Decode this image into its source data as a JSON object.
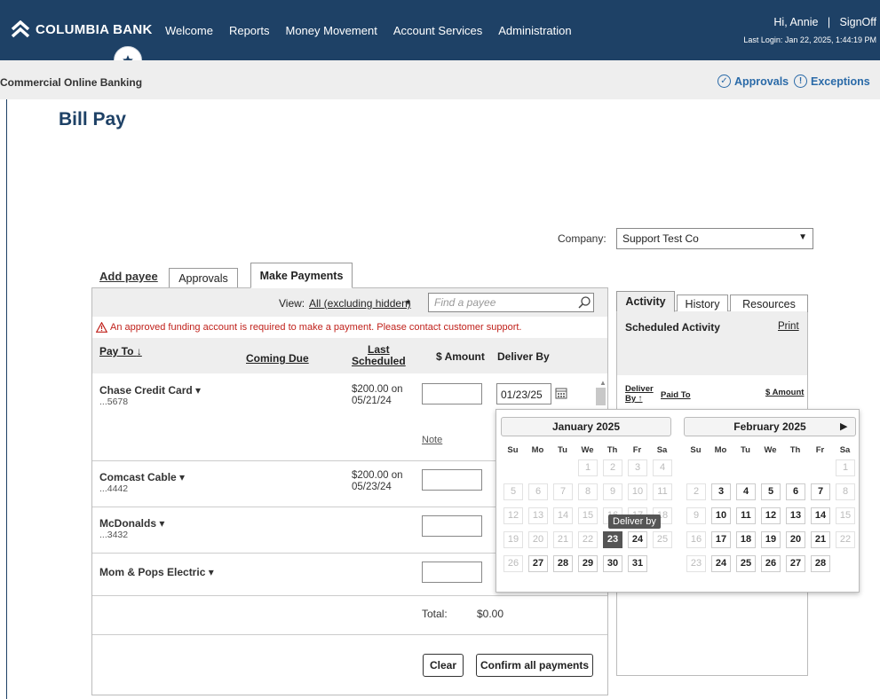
{
  "header": {
    "brand": "COLUMBIA BANK",
    "nav": [
      "Welcome",
      "Reports",
      "Money Movement",
      "Account Services",
      "Administration"
    ],
    "greeting": "Hi, Annie",
    "separator": "|",
    "signoff": "SignOff",
    "last_login": "Last Login: Jan 22, 2025, 1:44:19 PM"
  },
  "subbar": {
    "product": "Commercial Online Banking",
    "approvals": "Approvals",
    "exceptions": "Exceptions"
  },
  "page": {
    "title": "Bill Pay"
  },
  "company": {
    "label": "Company:",
    "value": "Support Test Co"
  },
  "tabs": {
    "add_payee": "Add payee",
    "approvals": "Approvals",
    "make_payments": "Make Payments"
  },
  "toolbar": {
    "view_label": "View:",
    "view_value": "All (excluding hidden)",
    "find_placeholder": "Find a payee"
  },
  "warning": "An approved funding account is required to make a payment. Please contact customer support.",
  "columns": {
    "pay_to": "Pay To",
    "coming_due": "Coming Due",
    "last_1": "Last",
    "last_2": "Scheduled",
    "amount": "$ Amount",
    "deliver_by": "Deliver By"
  },
  "payees": [
    {
      "name": "Chase Credit Card",
      "acct": "...5678",
      "last_1": "$200.00 on",
      "last_2": "05/21/24"
    },
    {
      "name": "Comcast Cable",
      "acct": "...4442",
      "last_1": "$200.00 on",
      "last_2": "05/23/24"
    },
    {
      "name": "McDonalds",
      "acct": "...3432",
      "last_1": "",
      "last_2": ""
    },
    {
      "name": "Mom & Pops Electric",
      "acct": "",
      "last_1": "",
      "last_2": ""
    }
  ],
  "deliver_date": "01/23/25",
  "note_label": "Note",
  "total": {
    "label": "Total:",
    "value": "$0.00"
  },
  "buttons": {
    "clear": "Clear",
    "confirm": "Confirm all payments"
  },
  "activity": {
    "tabs": [
      "Activity",
      "History",
      "Resources"
    ],
    "scheduled": "Scheduled Activity",
    "print": "Print",
    "col_deliver_1": "Deliver",
    "col_deliver_2": "By ↑",
    "col_paid_to": "Paid To",
    "col_amount": "$ Amount"
  },
  "calendar": {
    "tooltip": "Deliver by",
    "dow": [
      "Su",
      "Mo",
      "Tu",
      "We",
      "Th",
      "Fr",
      "Sa"
    ],
    "months": [
      {
        "title": "January 2025",
        "weeks": [
          [
            "",
            "",
            "",
            "1",
            "2",
            "3",
            "4"
          ],
          [
            "5",
            "6",
            "7",
            "8",
            "9",
            "10",
            "11"
          ],
          [
            "12",
            "13",
            "14",
            "15",
            "16",
            "17",
            "18"
          ],
          [
            "19",
            "20",
            "21",
            "22",
            "23",
            "24",
            "25"
          ],
          [
            "26",
            "27",
            "28",
            "29",
            "30",
            "31",
            ""
          ]
        ],
        "enabled": [
          "24",
          "27",
          "28",
          "29",
          "30",
          "31"
        ],
        "selected": "23"
      },
      {
        "title": "February 2025",
        "weeks": [
          [
            "",
            "",
            "",
            "",
            "",
            "",
            "1"
          ],
          [
            "2",
            "3",
            "4",
            "5",
            "6",
            "7",
            "8"
          ],
          [
            "9",
            "10",
            "11",
            "12",
            "13",
            "14",
            "15"
          ],
          [
            "16",
            "17",
            "18",
            "19",
            "20",
            "21",
            "22"
          ],
          [
            "23",
            "24",
            "25",
            "26",
            "27",
            "28",
            ""
          ]
        ],
        "enabled": [
          "3",
          "4",
          "5",
          "6",
          "7",
          "10",
          "11",
          "12",
          "13",
          "14",
          "17",
          "18",
          "19",
          "20",
          "21",
          "24",
          "25",
          "26",
          "27",
          "28"
        ],
        "selected": ""
      }
    ]
  }
}
